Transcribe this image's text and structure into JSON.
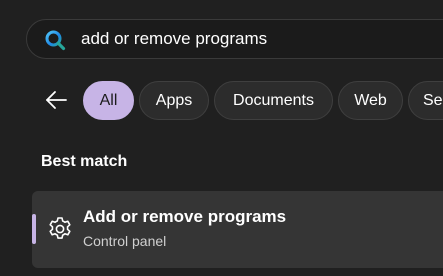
{
  "search": {
    "value": "add or remove programs"
  },
  "filters": {
    "items": [
      {
        "label": "All",
        "active": true
      },
      {
        "label": "Apps",
        "active": false
      },
      {
        "label": "Documents",
        "active": false
      },
      {
        "label": "Web",
        "active": false
      },
      {
        "label": "Se",
        "active": false
      }
    ]
  },
  "best_match": {
    "heading": "Best match",
    "result": {
      "title": "Add or remove programs",
      "subtitle": "Control panel",
      "icon": "gear-icon"
    }
  },
  "colors": {
    "background": "#202020",
    "accent": "#c7b4e6",
    "card": "#353535",
    "chip": "#2c2c2c"
  }
}
